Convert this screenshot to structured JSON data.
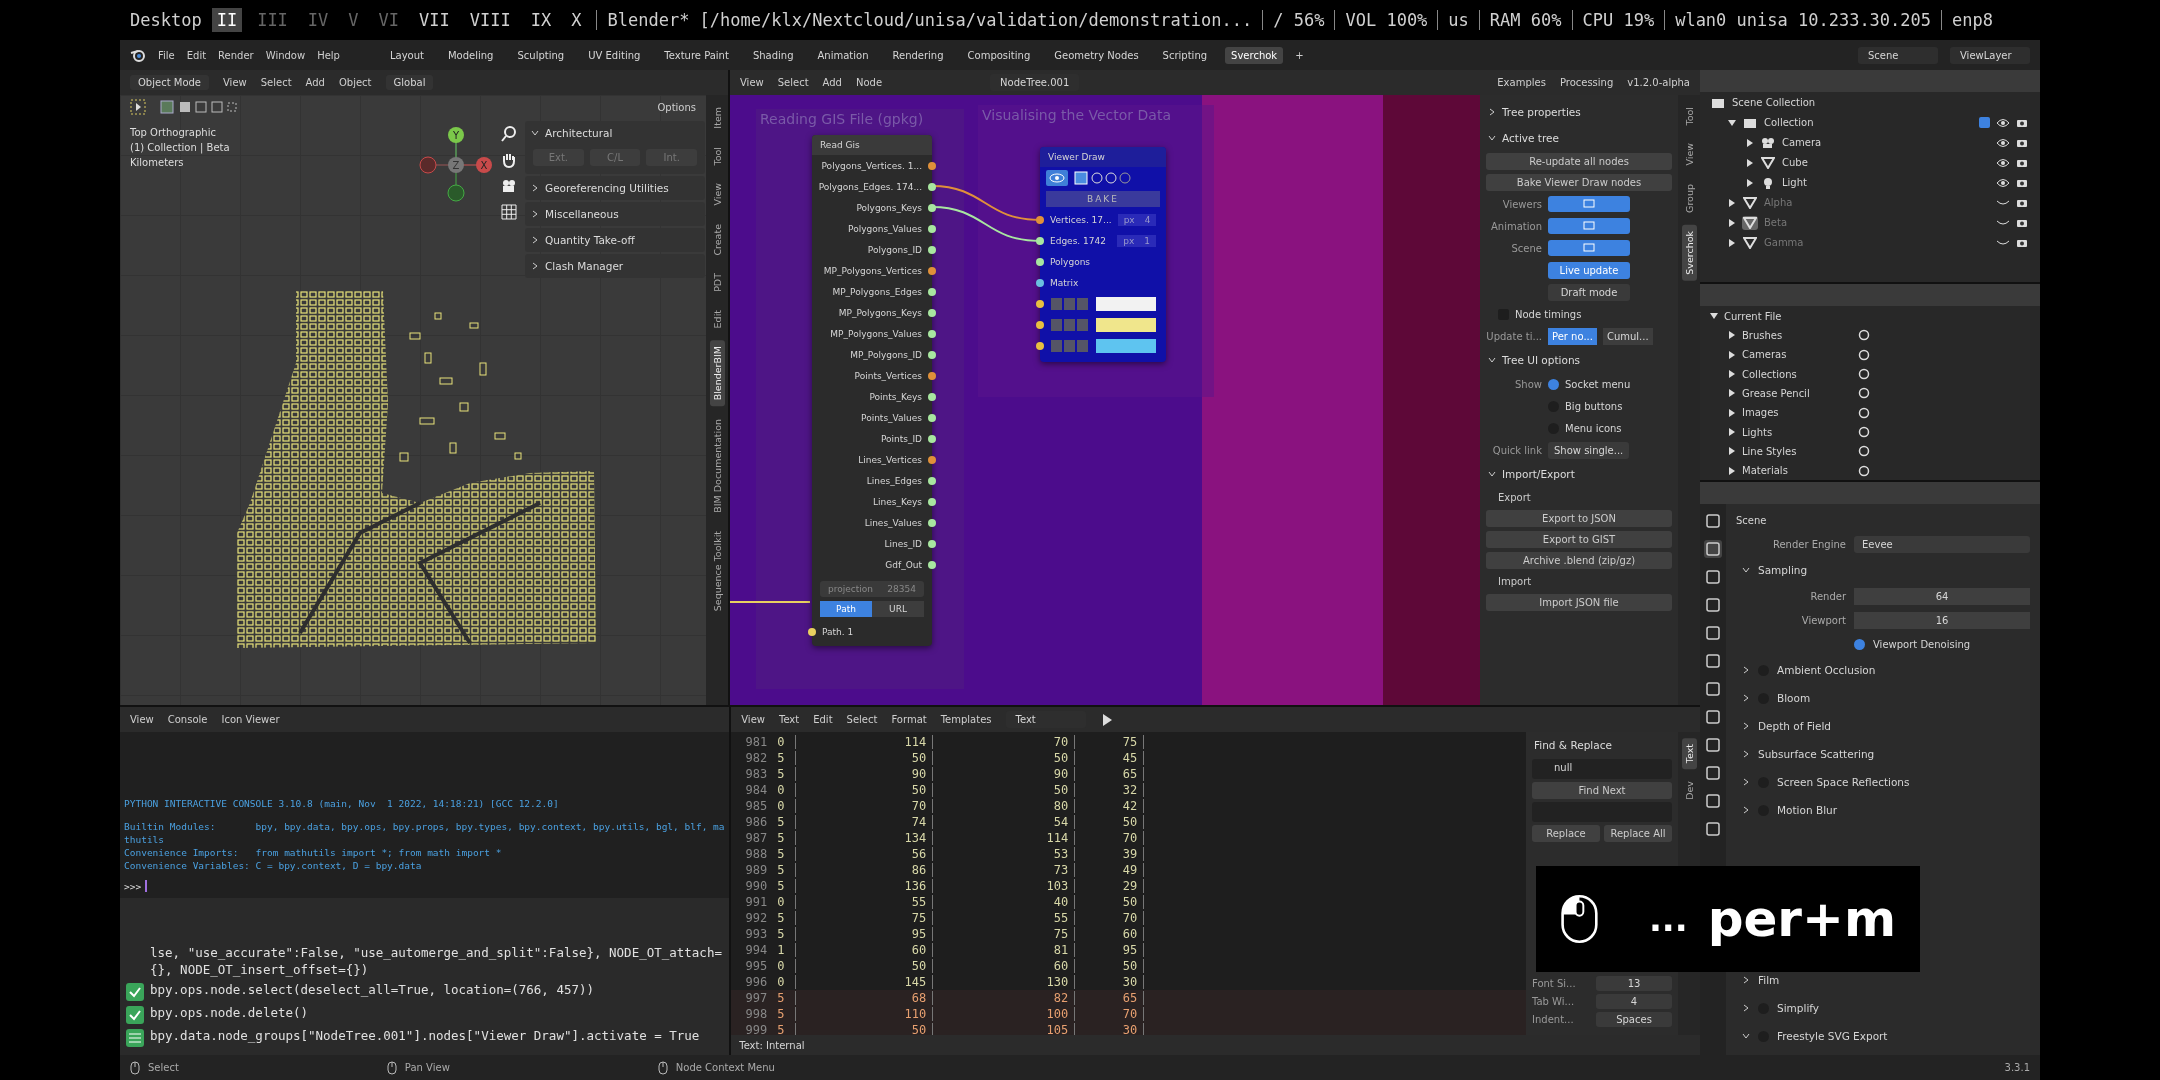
{
  "top_bar": {
    "label": "Desktop",
    "workspaces": [
      {
        "label": "II",
        "selected": true,
        "occupied": true
      },
      {
        "label": "III",
        "selected": false,
        "occupied": false
      },
      {
        "label": "IV",
        "selected": false,
        "occupied": false
      },
      {
        "label": "V",
        "selected": false,
        "occupied": false
      },
      {
        "label": "VI",
        "selected": false,
        "occupied": false
      },
      {
        "label": "VII",
        "selected": false,
        "occupied": true
      },
      {
        "label": "VIII",
        "selected": false,
        "occupied": true
      },
      {
        "label": "IX",
        "selected": false,
        "occupied": true
      },
      {
        "label": "X",
        "selected": false,
        "occupied": true
      }
    ],
    "window_title": "Blender* [/home/klx/Nextcloud/unisa/validation/demonstration...",
    "indicators": [
      "/ 56%",
      "VOL 100%",
      "us",
      "RAM 60%",
      "CPU 19%",
      "wlan0 unisa 10.233.30.205",
      "enp8"
    ]
  },
  "menu": [
    "File",
    "Edit",
    "Render",
    "Window",
    "Help"
  ],
  "workspace_tabs": [
    {
      "label": "Layout",
      "selected": false
    },
    {
      "label": "Modeling",
      "selected": false
    },
    {
      "label": "Sculpting",
      "selected": false
    },
    {
      "label": "UV Editing",
      "selected": false
    },
    {
      "label": "Texture Paint",
      "selected": false
    },
    {
      "label": "Shading",
      "selected": false
    },
    {
      "label": "Animation",
      "selected": false
    },
    {
      "label": "Rendering",
      "selected": false
    },
    {
      "label": "Compositing",
      "selected": false
    },
    {
      "label": "Geometry Nodes",
      "selected": false
    },
    {
      "label": "Scripting",
      "selected": false
    },
    {
      "label": "Sverchok",
      "selected": true
    }
  ],
  "add_workspace": "+",
  "scene": "Scene",
  "view_layer": "ViewLayer",
  "viewport": {
    "mode": "Object Mode",
    "menu": [
      "View",
      "Select",
      "Add",
      "Object"
    ],
    "orientation": "Global",
    "options": "Options",
    "overlay_text": [
      "Top Orthographic",
      "(1) Collection | Beta",
      "Kilometers"
    ],
    "gizmo": {
      "x": "X",
      "y": "Y",
      "z": "Z"
    },
    "panels": [
      {
        "title": "Architectural",
        "expanded": true,
        "buttons": [
          "Ext.",
          "C/L",
          "Int."
        ]
      },
      {
        "title": "Georeferencing Utilities",
        "expanded": false
      },
      {
        "title": "Miscellaneous",
        "expanded": false
      },
      {
        "title": "Quantity Take-off",
        "expanded": false
      },
      {
        "title": "Clash Manager",
        "expanded": false
      }
    ],
    "tabs": [
      {
        "label": "Item",
        "selected": false
      },
      {
        "label": "Tool",
        "selected": false
      },
      {
        "label": "View",
        "selected": false
      },
      {
        "label": "Create",
        "selected": false
      },
      {
        "label": "PDT",
        "selected": false
      },
      {
        "label": "Edit",
        "selected": false
      },
      {
        "label": "BlenderBIM",
        "selected": true
      },
      {
        "label": "BIM Documentation",
        "selected": false
      },
      {
        "label": "Sequence Toolkit",
        "selected": false
      }
    ]
  },
  "node_editor": {
    "menu": [
      "View",
      "Select",
      "Add",
      "Node"
    ],
    "tree_name": "NodeTree.001",
    "examples": "Examples",
    "processing": "Processing",
    "version": "v1.2.0-alpha",
    "frames": [
      {
        "label": "Reading GIS File (gpkg)"
      },
      {
        "label": "Visualising the Vector Data"
      }
    ],
    "read_node": {
      "title": "Read Gis",
      "outputs": [
        {
          "name": "Polygons_Vertices. 1...",
          "color": "#e0903a"
        },
        {
          "name": "Polygons_Edges. 174...",
          "color": "#a8e6a0"
        },
        {
          "name": "Polygons_Keys",
          "color": "#a8e6a0"
        },
        {
          "name": "Polygons_Values",
          "color": "#a8e6a0"
        },
        {
          "name": "Polygons_ID",
          "color": "#a8e6a0"
        },
        {
          "name": "MP_Polygons_Vertices",
          "color": "#e0903a"
        },
        {
          "name": "MP_Polygons_Edges",
          "color": "#a8e6a0"
        },
        {
          "name": "MP_Polygons_Keys",
          "color": "#a8e6a0"
        },
        {
          "name": "MP_Polygons_Values",
          "color": "#a8e6a0"
        },
        {
          "name": "MP_Polygons_ID",
          "color": "#a8e6a0"
        },
        {
          "name": "Points_Vertices",
          "color": "#e0903a"
        },
        {
          "name": "Points_Keys",
          "color": "#a8e6a0"
        },
        {
          "name": "Points_Values",
          "color": "#a8e6a0"
        },
        {
          "name": "Points_ID",
          "color": "#a8e6a0"
        },
        {
          "name": "Lines_Vertices",
          "color": "#e0903a"
        },
        {
          "name": "Lines_Edges",
          "color": "#a8e6a0"
        },
        {
          "name": "Lines_Keys",
          "color": "#a8e6a0"
        },
        {
          "name": "Lines_Values",
          "color": "#a8e6a0"
        },
        {
          "name": "Lines_ID",
          "color": "#a8e6a0"
        },
        {
          "name": "Gdf_Out",
          "color": "#a8e6a0"
        }
      ],
      "projection_label": "projection",
      "projection": "28354",
      "source_modes": [
        {
          "label": "Path",
          "selected": true
        },
        {
          "label": "URL",
          "selected": false
        }
      ],
      "input": "Path. 1"
    },
    "viewer_node": {
      "title": "Viewer Draw",
      "bake": "BAKE",
      "inputs": [
        {
          "name": "Vertices. 17...",
          "color": "#e0903a",
          "unit": "px",
          "value": "4"
        },
        {
          "name": "Edges. 1742",
          "color": "#a8e6a0",
          "unit": "px",
          "value": "1"
        },
        {
          "name": "Polygons",
          "color": "#a8e6a0"
        },
        {
          "name": "Matrix",
          "color": "#6ac0e0"
        }
      ],
      "color_rows": [
        {
          "color": "#f2f2f2"
        },
        {
          "color": "#f0e68c"
        },
        {
          "color": "#5ec4f0"
        }
      ]
    }
  },
  "sverchok": {
    "tabs": [
      {
        "label": "Tool",
        "selected": false
      },
      {
        "label": "View",
        "selected": false
      },
      {
        "label": "Group",
        "selected": false
      },
      {
        "label": "Sverchok",
        "selected": true
      }
    ],
    "tree_properties": {
      "title": "Tree properties",
      "expanded": false
    },
    "active_tree": {
      "title": "Active tree",
      "expanded": true,
      "buttons": [
        "Re-update all nodes",
        "Bake Viewer Draw nodes"
      ],
      "toggles": [
        {
          "label": "Viewers",
          "on": true
        },
        {
          "label": "Animation",
          "on": true
        },
        {
          "label": "Scene",
          "on": true
        }
      ],
      "live_update": {
        "label": "Live update",
        "on": true
      },
      "draft_mode": {
        "label": "Draft mode",
        "on": false
      },
      "node_timings": {
        "label": "Node timings",
        "checked": false
      },
      "update_label": "Update ti...",
      "update_modes": [
        {
          "label": "Per no...",
          "selected": true
        },
        {
          "label": "Cumul...",
          "selected": false
        }
      ]
    },
    "tree_ui": {
      "title": "Tree UI options",
      "expanded": true,
      "show_label": "Show",
      "options": [
        {
          "label": "Socket menu",
          "checked": true
        },
        {
          "label": "Big buttons",
          "checked": false
        },
        {
          "label": "Menu icons",
          "checked": false
        }
      ],
      "quick_link_label": "Quick link",
      "quick_link": "Show single..."
    },
    "import_export": {
      "title": "Import/Export",
      "expanded": true,
      "export_title": "Export",
      "export_buttons": [
        "Export to JSON",
        "Export to GIST",
        "Archive .blend (zip/gz)"
      ],
      "import_title": "Import",
      "import_buttons": [
        "Import JSON file"
      ]
    }
  },
  "outliner": {
    "items": [
      {
        "name": "Scene Collection",
        "kind": "scene",
        "children": [
          {
            "name": "Collection",
            "kind": "collection",
            "expanded": true,
            "checked": true,
            "excluded": false,
            "active": false,
            "children": [
              {
                "name": "Camera",
                "kind": "camera",
                "expanded": false,
                "excluded": false,
                "active": false
              },
              {
                "name": "Cube",
                "kind": "mesh",
                "expanded": false,
                "excluded": false,
                "active": false
              },
              {
                "name": "Light",
                "kind": "light",
                "expanded": false,
                "excluded": false,
                "active": false
              }
            ]
          },
          {
            "name": "Alpha",
            "kind": "mesh",
            "expanded": false,
            "excluded": true,
            "active": false
          },
          {
            "name": "Beta",
            "kind": "mesh",
            "expanded": false,
            "excluded": true,
            "active": true
          },
          {
            "name": "Gamma",
            "kind": "mesh",
            "expanded": false,
            "excluded": true,
            "active": false
          }
        ]
      }
    ]
  },
  "data_outliner": {
    "root": "Current File",
    "items": [
      "Brushes",
      "Cameras",
      "Collections",
      "Grease Pencil",
      "Images",
      "Lights",
      "Line Styles",
      "Materials"
    ]
  },
  "properties": {
    "context": "Scene",
    "render_engine_label": "Render Engine",
    "render_engine": "Eevee",
    "sampling": {
      "title": "Sampling",
      "expanded": true,
      "fields": [
        {
          "label": "Render",
          "value": "64"
        },
        {
          "label": "Viewport",
          "value": "16"
        }
      ],
      "denoising": {
        "label": "Viewport Denoising",
        "checked": true
      }
    },
    "panels_top": [
      {
        "title": "Ambient Occlusion",
        "kind": "toggle",
        "checked": false,
        "expanded": false
      },
      {
        "title": "Bloom",
        "kind": "toggle",
        "checked": false,
        "expanded": false
      },
      {
        "title": "Depth of Field",
        "kind": "plain",
        "expanded": false
      },
      {
        "title": "Subsurface Scattering",
        "kind": "plain",
        "expanded": false
      },
      {
        "title": "Screen Space Reflections",
        "kind": "toggle",
        "checked": false,
        "expanded": false
      },
      {
        "title": "Motion Blur",
        "kind": "toggle",
        "checked": false,
        "expanded": false
      }
    ],
    "panels_bottom": [
      {
        "title": "Film",
        "kind": "plain",
        "expanded": false
      },
      {
        "title": "Simplify",
        "kind": "toggle",
        "checked": false,
        "expanded": false
      },
      {
        "title": "Freestyle SVG Export",
        "kind": "toggle",
        "checked": false,
        "expanded": true
      }
    ]
  },
  "console": {
    "menu": [
      "View",
      "Console",
      "Icon Viewer"
    ],
    "lines": [
      "PYTHON INTERACTIVE CONSOLE 3.10.8 (main, Nov  1 2022, 14:18:21) [GCC 12.2.0]",
      "Builtin Modules:       bpy, bpy.data, bpy.ops, bpy.props, bpy.types, bpy.context, bpy.utils, bgl, blf, mathutils",
      "Convenience Imports:   from mathutils import *; from math import *",
      "Convenience Variables: C = bpy.context, D = bpy.data"
    ],
    "prompt": ">>>",
    "info_log": [
      {
        "kind": "continued",
        "text": "lse, \"use_accurate\":False, \"use_automerge_and_split\":False}, NODE_OT_attach={}, NODE_OT_insert_offset={})"
      },
      {
        "kind": "operator",
        "text": "bpy.ops.node.select(deselect_all=True, location=(766, 457))"
      },
      {
        "kind": "operator",
        "text": "bpy.ops.node.delete()"
      },
      {
        "kind": "property",
        "text": "bpy.data.node_groups[\"NodeTree.001\"].nodes[\"Viewer Draw\"].activate = True"
      }
    ]
  },
  "text_editor": {
    "menu": [
      "View",
      "Text",
      "Edit",
      "Select",
      "Format",
      "Templates"
    ],
    "text_name": "Text",
    "rows": [
      {
        "line": "981",
        "cells": [
          "0",
          "114",
          "70",
          "75"
        ],
        "highlighted": false
      },
      {
        "line": "982",
        "cells": [
          "5",
          "50",
          "50",
          "45"
        ],
        "highlighted": false
      },
      {
        "line": "983",
        "cells": [
          "5",
          "90",
          "90",
          "65"
        ],
        "highlighted": false
      },
      {
        "line": "984",
        "cells": [
          "0",
          "50",
          "50",
          "32"
        ],
        "highlighted": false
      },
      {
        "line": "985",
        "cells": [
          "0",
          "70",
          "80",
          "42"
        ],
        "highlighted": false
      },
      {
        "line": "986",
        "cells": [
          "5",
          "74",
          "54",
          "50"
        ],
        "highlighted": false
      },
      {
        "line": "987",
        "cells": [
          "5",
          "134",
          "114",
          "70"
        ],
        "highlighted": false
      },
      {
        "line": "988",
        "cells": [
          "5",
          "56",
          "53",
          "39"
        ],
        "highlighted": false
      },
      {
        "line": "989",
        "cells": [
          "5",
          "86",
          "73",
          "49"
        ],
        "highlighted": false
      },
      {
        "line": "990",
        "cells": [
          "5",
          "136",
          "103",
          "29"
        ],
        "highlighted": false
      },
      {
        "line": "991",
        "cells": [
          "0",
          "55",
          "40",
          "50"
        ],
        "highlighted": false
      },
      {
        "line": "992",
        "cells": [
          "5",
          "75",
          "55",
          "70"
        ],
        "highlighted": false
      },
      {
        "line": "993",
        "cells": [
          "5",
          "95",
          "75",
          "60"
        ],
        "highlighted": false
      },
      {
        "line": "994",
        "cells": [
          "1",
          "60",
          "81",
          "95"
        ],
        "highlighted": false
      },
      {
        "line": "995",
        "cells": [
          "0",
          "50",
          "60",
          "50"
        ],
        "highlighted": false
      },
      {
        "line": "996",
        "cells": [
          "0",
          "145",
          "130",
          "30"
        ],
        "highlighted": false
      },
      {
        "line": "997",
        "cells": [
          "5",
          "68",
          "82",
          "65"
        ],
        "highlighted": true
      },
      {
        "line": "998",
        "cells": [
          "5",
          "110",
          "100",
          "70"
        ],
        "highlighted": true
      },
      {
        "line": "999",
        "cells": [
          "5",
          "50",
          "105",
          "30"
        ],
        "highlighted": true
      }
    ],
    "footer": "Text: Internal",
    "find": {
      "title": "Find & Replace",
      "query": "null",
      "find_next": "Find Next",
      "replace": "Replace",
      "replace_all": "Replace All",
      "settings": [
        {
          "label": "Font Si...",
          "value": "13"
        },
        {
          "label": "Tab Wi...",
          "value": "4"
        },
        {
          "label": "Indent...",
          "value": "Spaces"
        }
      ]
    },
    "tabs": [
      {
        "label": "Text",
        "selected": true
      },
      {
        "label": "Dev",
        "selected": false
      }
    ]
  },
  "key_overlay": {
    "keys": "...",
    "text": "per+m"
  },
  "status_bar": {
    "hints": [
      "Select",
      "Pan View",
      "Node Context Menu"
    ],
    "version": "3.3.1"
  }
}
